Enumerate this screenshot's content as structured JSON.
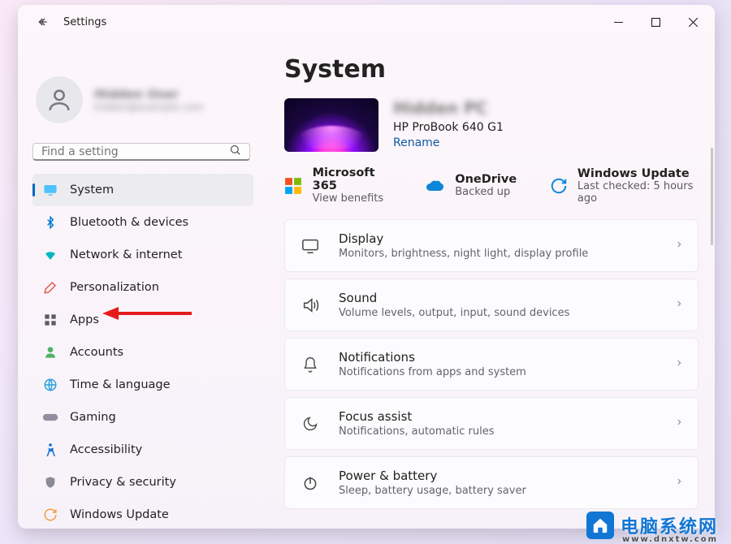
{
  "window": {
    "title": "Settings",
    "page_heading": "System"
  },
  "search": {
    "placeholder": "Find a setting"
  },
  "profile": {
    "name": "Hidden User",
    "email": "hidden@example.com"
  },
  "nav": {
    "items": [
      {
        "id": "system",
        "label": "System",
        "icon": "monitor",
        "color": "#4cc2ff",
        "selected": true
      },
      {
        "id": "bluetooth",
        "label": "Bluetooth & devices",
        "icon": "bluetooth",
        "color": "#0078d4",
        "selected": false
      },
      {
        "id": "network",
        "label": "Network & internet",
        "icon": "wifi",
        "color": "#00b7c3",
        "selected": false
      },
      {
        "id": "personalize",
        "label": "Personalization",
        "icon": "brush",
        "color": "#e3574b",
        "selected": false
      },
      {
        "id": "apps",
        "label": "Apps",
        "icon": "apps",
        "color": "#5b5b68",
        "selected": false
      },
      {
        "id": "accounts",
        "label": "Accounts",
        "icon": "person",
        "color": "#4fb06a",
        "selected": false
      },
      {
        "id": "time",
        "label": "Time & language",
        "icon": "globe",
        "color": "#2aa0d8",
        "selected": false
      },
      {
        "id": "gaming",
        "label": "Gaming",
        "icon": "gamepad",
        "color": "#8f8fa0",
        "selected": false
      },
      {
        "id": "accessibility",
        "label": "Accessibility",
        "icon": "accessibility",
        "color": "#1d79d4",
        "selected": false
      },
      {
        "id": "privacy",
        "label": "Privacy & security",
        "icon": "shield",
        "color": "#8a8a95",
        "selected": false
      },
      {
        "id": "update",
        "label": "Windows Update",
        "icon": "update",
        "color": "#f0a54b",
        "selected": false
      }
    ]
  },
  "device": {
    "name": "Hidden PC",
    "model": "HP ProBook 640 G1",
    "rename": "Rename"
  },
  "status": {
    "m365": {
      "title": "Microsoft 365",
      "sub": "View benefits"
    },
    "onedrive": {
      "title": "OneDrive",
      "sub": "Backed up"
    },
    "update": {
      "title": "Windows Update",
      "sub": "Last checked: 5 hours ago"
    }
  },
  "cards": [
    {
      "id": "display",
      "title": "Display",
      "sub": "Monitors, brightness, night light, display profile",
      "icon": "display"
    },
    {
      "id": "sound",
      "title": "Sound",
      "sub": "Volume levels, output, input, sound devices",
      "icon": "sound"
    },
    {
      "id": "notifications",
      "title": "Notifications",
      "sub": "Notifications from apps and system",
      "icon": "bell"
    },
    {
      "id": "focus",
      "title": "Focus assist",
      "sub": "Notifications, automatic rules",
      "icon": "moon"
    },
    {
      "id": "power",
      "title": "Power & battery",
      "sub": "Sleep, battery usage, battery saver",
      "icon": "power"
    }
  ],
  "watermark": {
    "text": "电脑系统网",
    "url": "www.dnxtw.com"
  }
}
